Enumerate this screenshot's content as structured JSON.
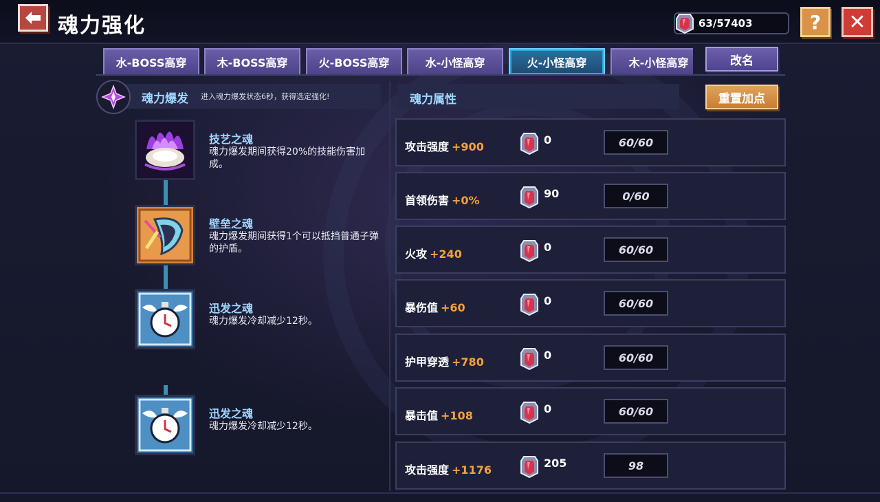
{
  "header": {
    "title": "魂力强化",
    "currency": "63/57403",
    "help_label": "?",
    "close_label": "✕"
  },
  "tabs": [
    {
      "label": "水-BOSS高穿"
    },
    {
      "label": "木-BOSS高穿"
    },
    {
      "label": "火-BOSS高穿"
    },
    {
      "label": "水-小怪高穿"
    },
    {
      "label": "火-小怪高穿",
      "active": true
    },
    {
      "label": "木-小怪高穿"
    }
  ],
  "buttons": {
    "rename": "改名",
    "reset": "重置加点"
  },
  "burst": {
    "title": "魂力爆发",
    "description": "进入魂力爆发状态6秒，获得选定强化!"
  },
  "souls": [
    {
      "name": "技艺之魂",
      "description": "魂力爆发期间获得20%的技能伤害加成。",
      "icon": "purple-flame-shell-icon"
    },
    {
      "name": "壁垒之魂",
      "description": "魂力爆发期间获得1个可以抵挡普通子弹的护盾。",
      "icon": "shield-icon"
    },
    {
      "name": "迅发之魂",
      "description": "魂力爆发冷却减少12秒。",
      "icon": "winged-stopwatch-icon"
    },
    {
      "name": "迅发之魂",
      "description": "魂力爆发冷却减少12秒。",
      "icon": "winged-stopwatch-icon"
    }
  ],
  "attributes": {
    "title": "魂力属性",
    "rows": [
      {
        "label": "攻击强度",
        "bonus": "+900",
        "cost": "0",
        "level": "60/60"
      },
      {
        "label": "首领伤害",
        "bonus": "+0%",
        "cost": "90",
        "level": "0/60"
      },
      {
        "label": "火攻",
        "bonus": "+240",
        "cost": "0",
        "level": "60/60"
      },
      {
        "label": "暴伤值",
        "bonus": "+60",
        "cost": "0",
        "level": "60/60"
      },
      {
        "label": "护甲穿透",
        "bonus": "+780",
        "cost": "0",
        "level": "60/60"
      },
      {
        "label": "暴击值",
        "bonus": "+108",
        "cost": "0",
        "level": "60/60"
      },
      {
        "label": "攻击强度",
        "bonus": "+1176",
        "cost": "205",
        "level": "98"
      }
    ]
  },
  "colors": {
    "accent_blue": "#9fd6ff",
    "bonus_orange": "#f5a23a",
    "active_tab": "#2e6f9e"
  }
}
